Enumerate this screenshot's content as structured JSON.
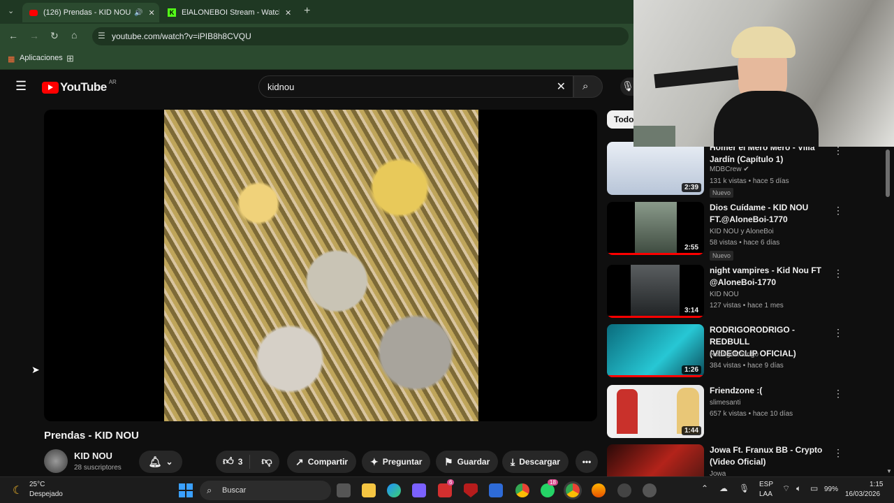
{
  "browser": {
    "tabs": [
      {
        "title": "(126) Prendas - KID NOU -",
        "active": true
      },
      {
        "title": "ElALONEBOI Stream - Watch Li",
        "active": false
      }
    ],
    "url": "youtube.com/watch?v=iPIB8h8CVQU",
    "bookmarks": {
      "apps_label": "Aplicaciones"
    }
  },
  "youtube": {
    "logo_text": "YouTube",
    "region": "AR",
    "search_query": "kidnou",
    "filter_chip": "Todos",
    "video": {
      "title": "Prendas - KID NOU",
      "channel": "KID NOU",
      "subscribers": "28 suscriptores",
      "likes": "3",
      "share_label": "Compartir",
      "ask_label": "Preguntar",
      "save_label": "Guardar",
      "download_label": "Descargar"
    },
    "recommendations": [
      {
        "title_line1": "Homer el Mero Mero - Villa",
        "title_line2": "Jardín (Capítulo 1)",
        "channel": "MDBCrew",
        "meta": "131 k vistas • hace 5 días",
        "badge": "Nuevo",
        "duration": "2:39",
        "thumb_color": "#cfd8e8"
      },
      {
        "title_line1": "Dios Cuídame - KID NOU",
        "title_line2": "FT.@AloneBoi-1770",
        "channel": "KID NOU y AloneBoi",
        "meta": "58 vistas • hace 6 días",
        "badge": "Nuevo",
        "duration": "2:55",
        "thumb_color": "#5a6a5f"
      },
      {
        "title_line1": "night vampires - Kid Nou FT",
        "title_line2": "@AloneBoi-1770",
        "channel": "KID NOU",
        "meta": "127 vistas • hace 1 mes",
        "badge": "",
        "duration": "3:14",
        "thumb_color": "#3a3d3f"
      },
      {
        "title_line1": "RODRIGORODRIGO - REDBULL",
        "title_line2": "(VIDEOCLIP OFICIAL)",
        "channel": "RodrigoRodrigo",
        "meta": "384 vistas • hace 9 días",
        "badge": "",
        "duration": "1:26",
        "thumb_color": "#1fb7c4"
      },
      {
        "title_line1": "Friendzone :(",
        "title_line2": "",
        "channel": "slimesanti",
        "meta": "657 k vistas • hace 10 días",
        "badge": "",
        "duration": "1:44",
        "thumb_color": "#eeeeee"
      },
      {
        "title_line1": "Jowa Ft. Franux BB - Crypto",
        "title_line2": "(Video Oficial)",
        "channel": "Jowa",
        "meta": "",
        "badge": "",
        "duration": "",
        "thumb_color": "#7a1a12"
      }
    ]
  },
  "taskbar": {
    "weather_temp": "25°C",
    "weather_desc": "Despejado",
    "search_label": "Buscar",
    "lang_line1": "ESP",
    "lang_line2": "LAA",
    "battery": "99%",
    "time": "1:15",
    "date": "16/03/2026",
    "badges": {
      "mail": "6",
      "whatsapp": "18"
    }
  },
  "colors": {
    "accent_red": "#ff0000",
    "chrome_green": "#2b4a2f"
  }
}
